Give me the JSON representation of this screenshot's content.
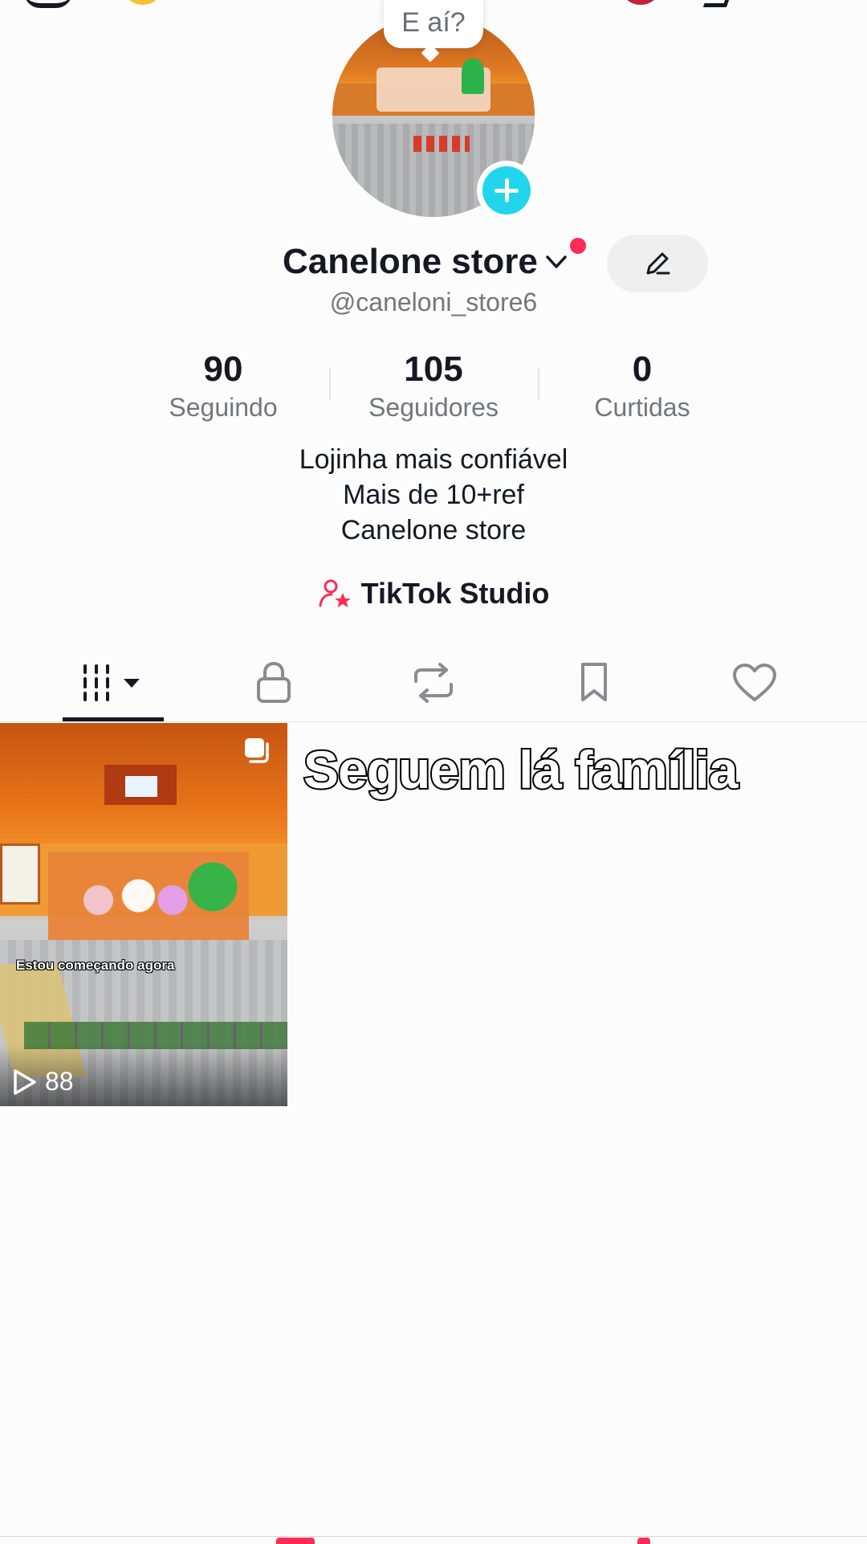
{
  "colors": {
    "accent": "#fe2c55",
    "add_badge": "#20d5ec",
    "text": "#161823",
    "muted": "#75767c"
  },
  "avatar_bubble": {
    "text": "E aí?"
  },
  "profile": {
    "name": "Canelone store",
    "handle": "@caneloni_store6",
    "stats": [
      {
        "value": "90",
        "label": "Seguindo"
      },
      {
        "value": "105",
        "label": "Seguidores"
      },
      {
        "value": "0",
        "label": "Curtidas"
      }
    ],
    "bio": [
      "Lojinha mais confiável",
      "Mais de 10+ref",
      "Canelone store"
    ],
    "studio_label": "TikTok Studio"
  },
  "tabs": [
    {
      "icon": "grid-icon",
      "selected": true
    },
    {
      "icon": "lock-icon",
      "selected": false
    },
    {
      "icon": "repost-icon",
      "selected": false
    },
    {
      "icon": "bookmark-icon",
      "selected": false
    },
    {
      "icon": "heart-icon",
      "selected": false
    }
  ],
  "videos": [
    {
      "caption": "Estou começando agora",
      "views": "88",
      "multi_photo": true
    }
  ],
  "overlay_title": "Seguem lá família"
}
